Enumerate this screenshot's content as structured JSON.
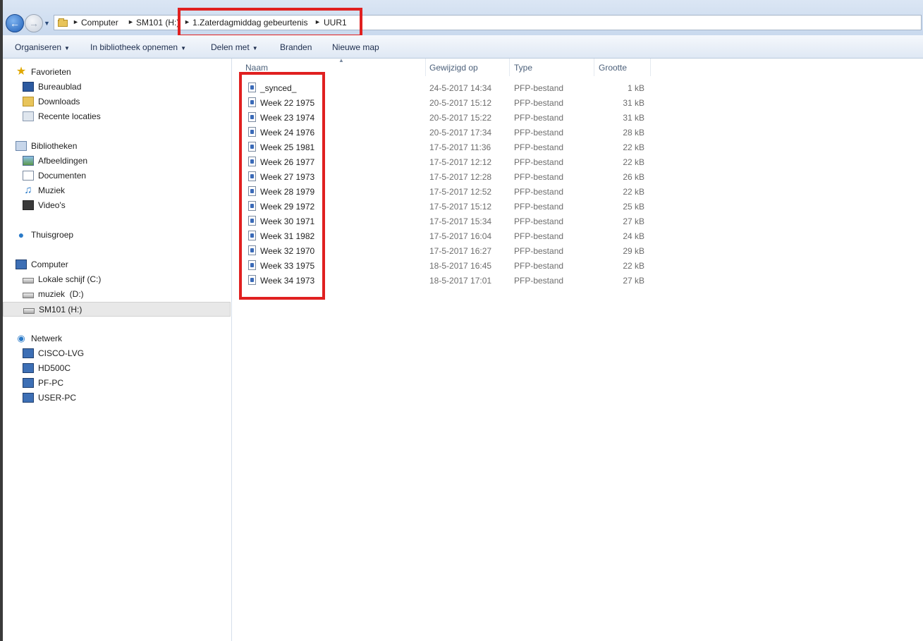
{
  "address": {
    "crumbs": [
      "Computer",
      "SM101 (H:)",
      "1.Zaterdagmiddag gebeurtenis",
      "UUR1"
    ]
  },
  "toolbar": {
    "organize": "Organiseren",
    "include_library": "In bibliotheek opnemen",
    "share": "Delen met",
    "burn": "Branden",
    "new_folder": "Nieuwe map"
  },
  "nav": {
    "favorites": "Favorieten",
    "desktop": "Bureaublad",
    "downloads": "Downloads",
    "recent": "Recente locaties",
    "libraries": "Bibliotheken",
    "pictures": "Afbeeldingen",
    "documents": "Documenten",
    "music": "Muziek",
    "videos": "Video's",
    "homegroup": "Thuisgroep",
    "computer": "Computer",
    "drive_c": "Lokale schijf (C:)",
    "drive_d": "muziek  (D:)",
    "drive_h": "SM101 (H:)",
    "network": "Netwerk",
    "pc1": "CISCO-LVG",
    "pc2": "HD500C",
    "pc3": "PF-PC",
    "pc4": "USER-PC"
  },
  "columns": {
    "name": "Naam",
    "modified": "Gewijzigd op",
    "type": "Type",
    "size": "Grootte"
  },
  "files": [
    {
      "name": "_synced_",
      "date": "24-5-2017 14:34",
      "type": "PFP-bestand",
      "size": "1 kB"
    },
    {
      "name": "Week 22 1975",
      "date": "20-5-2017 15:12",
      "type": "PFP-bestand",
      "size": "31 kB"
    },
    {
      "name": "Week 23 1974",
      "date": "20-5-2017 15:22",
      "type": "PFP-bestand",
      "size": "31 kB"
    },
    {
      "name": "Week 24 1976",
      "date": "20-5-2017 17:34",
      "type": "PFP-bestand",
      "size": "28 kB"
    },
    {
      "name": "Week 25 1981",
      "date": "17-5-2017 11:36",
      "type": "PFP-bestand",
      "size": "22 kB"
    },
    {
      "name": "Week 26 1977",
      "date": "17-5-2017 12:12",
      "type": "PFP-bestand",
      "size": "22 kB"
    },
    {
      "name": "Week 27 1973",
      "date": "17-5-2017 12:28",
      "type": "PFP-bestand",
      "size": "26 kB"
    },
    {
      "name": "Week 28 1979",
      "date": "17-5-2017 12:52",
      "type": "PFP-bestand",
      "size": "22 kB"
    },
    {
      "name": "Week 29 1972",
      "date": "17-5-2017 15:12",
      "type": "PFP-bestand",
      "size": "25 kB"
    },
    {
      "name": "Week 30 1971",
      "date": "17-5-2017 15:34",
      "type": "PFP-bestand",
      "size": "27 kB"
    },
    {
      "name": "Week 31 1982",
      "date": "17-5-2017 16:04",
      "type": "PFP-bestand",
      "size": "24 kB"
    },
    {
      "name": "Week 32 1970",
      "date": "17-5-2017 16:27",
      "type": "PFP-bestand",
      "size": "29 kB"
    },
    {
      "name": "Week 33 1975",
      "date": "18-5-2017 16:45",
      "type": "PFP-bestand",
      "size": "22 kB"
    },
    {
      "name": "Week 34 1973",
      "date": "18-5-2017 17:01",
      "type": "PFP-bestand",
      "size": "27 kB"
    }
  ],
  "icons": {
    "back": "back-arrow-icon",
    "forward": "forward-arrow-icon",
    "file": "pfp-file-icon"
  },
  "colors": {
    "highlight": "#e02020",
    "accent": "#1f5fb8"
  }
}
